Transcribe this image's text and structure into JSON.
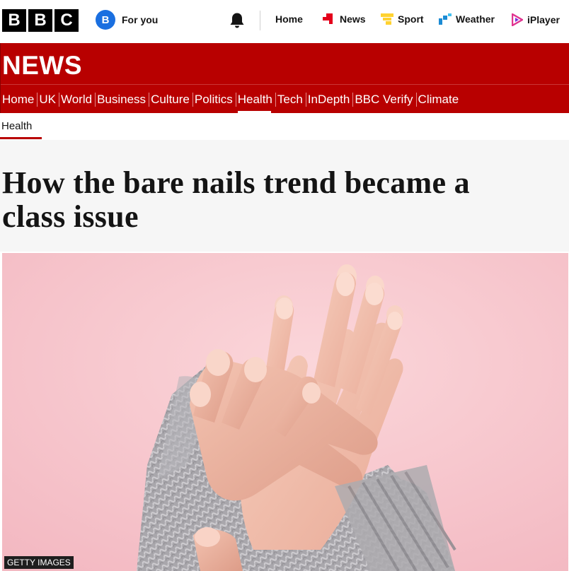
{
  "topbar": {
    "logo_letters": [
      "B",
      "B",
      "C"
    ],
    "foryou": {
      "badge": "B",
      "label": "For you"
    },
    "nav": [
      {
        "label": "Home",
        "icon": "none"
      },
      {
        "label": "News",
        "icon": "news-icon",
        "color": "#e4001b"
      },
      {
        "label": "Sport",
        "icon": "sport-icon",
        "color": "#ffd230"
      },
      {
        "label": "Weather",
        "icon": "weather-icon",
        "color": "#1c8bd4"
      },
      {
        "label": "iPlayer",
        "icon": "iplayer-icon",
        "color": "#e0338f"
      }
    ]
  },
  "masthead": {
    "title": "NEWS",
    "color": "#b80000",
    "nav": [
      "Home",
      "UK",
      "World",
      "Business",
      "Culture",
      "Politics",
      "Health",
      "Tech",
      "InDepth",
      "BBC Verify",
      "Climate"
    ],
    "active": "Health"
  },
  "subnav": {
    "label": "Health"
  },
  "article": {
    "headline_line1": "How the bare nails trend became a",
    "headline_line2": "class issue",
    "image_credit": "GETTY IMAGES"
  }
}
